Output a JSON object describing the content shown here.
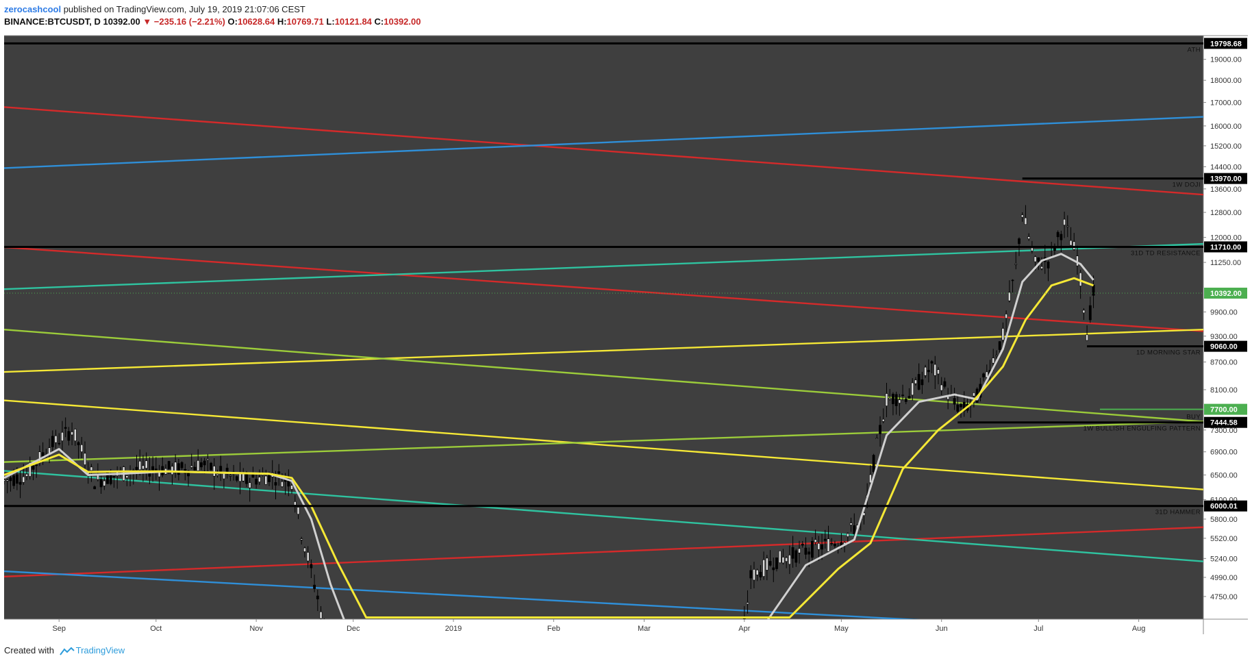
{
  "header": {
    "author": "zerocashcool",
    "published": " published on TradingView.com, July 19, 2019 21:07:06 CEST",
    "symbol": "BINANCE:BTCUSDT, D",
    "last": "10392.00",
    "change": "▼ −235.16 (−2.21%)",
    "o_label": "O:",
    "o_value": "10628.64",
    "h_label": "H:",
    "h_value": "10769.71",
    "l_label": "L:",
    "l_value": "10121.84",
    "c_label": "C:",
    "c_value": "10392.00"
  },
  "footer": {
    "created_with": "Created with",
    "brand": "TradingView"
  },
  "colors": {
    "plot_bg": "#3f3f3f",
    "red": "#d42a2a",
    "blue": "#2f8fd8",
    "teal": "#2fc3a0",
    "yellow": "#f5e836",
    "lime": "#9ccc3a",
    "ema_fast": "#d0d0d0",
    "ema_slow": "#f5e836",
    "candle": "#000000",
    "level": "#000000",
    "last_price": "#4caf50"
  },
  "chart_data": {
    "type": "line",
    "title": "",
    "xlabel": "",
    "ylabel": "",
    "ylim": [
      4480,
      20200
    ],
    "scale": "log",
    "grid": false,
    "x_ticks": [
      "Sep",
      "Oct",
      "Nov",
      "Dec",
      "2019",
      "Feb",
      "Mar",
      "Apr",
      "May",
      "Jun",
      "Jul",
      "Aug"
    ],
    "x_tick_dates": [
      "2018-09-01",
      "2018-10-01",
      "2018-11-01",
      "2018-12-01",
      "2019-01-01",
      "2019-02-01",
      "2019-03-01",
      "2019-04-01",
      "2019-05-01",
      "2019-06-01",
      "2019-07-01",
      "2019-08-01"
    ],
    "x_range": [
      "2018-08-15",
      "2019-08-21"
    ],
    "y_ticks": [
      19000,
      18000,
      17000,
      16000,
      15200,
      14400,
      13600,
      12800,
      12000,
      11250,
      9900,
      9300,
      8700,
      8100,
      7300,
      6900,
      6500,
      6100,
      5800,
      5520,
      5240,
      4990,
      4750
    ],
    "horizontal_levels": [
      {
        "price": 19798.68,
        "label": "19798.68",
        "annotation": "ATH",
        "from": "2018-08-15",
        "to": "2019-08-21"
      },
      {
        "price": 13970.0,
        "label": "13970.00",
        "annotation": "1W DOJI",
        "from": "2019-06-26",
        "to": "2019-08-21"
      },
      {
        "price": 11710.0,
        "label": "11710.00",
        "annotation": "31D TD RESISTANCE",
        "from": "2018-08-15",
        "to": "2019-08-21"
      },
      {
        "price": 9060.0,
        "label": "9060.00",
        "annotation": "1D MORNING STAR",
        "from": "2019-07-16",
        "to": "2019-08-21"
      },
      {
        "price": 7444.58,
        "label": "7444.58",
        "annotation": "1W BULLISH ENGULFING PATTERN",
        "from": "2019-06-06",
        "to": "2019-08-21"
      },
      {
        "price": 6000.01,
        "label": "6000.01",
        "annotation": "31D HAMMER",
        "from": "2018-08-15",
        "to": "2019-08-21"
      }
    ],
    "buy_level": {
      "price": 7700.0,
      "label": "7700.00",
      "annotation": "BUY",
      "from": "2019-07-20",
      "to": "2019-08-21"
    },
    "last_price": {
      "price": 10392.0,
      "label": "10392.00"
    },
    "trend_lines": [
      {
        "color": "red",
        "from": [
          "2018-08-15",
          16800
        ],
        "to": [
          "2019-08-21",
          13400
        ]
      },
      {
        "color": "red",
        "from": [
          "2018-08-15",
          11700
        ],
        "to": [
          "2019-08-21",
          9420
        ]
      },
      {
        "color": "red",
        "from": [
          "2018-08-15",
          5000
        ],
        "to": [
          "2019-08-21",
          5680
        ]
      },
      {
        "color": "blue",
        "from": [
          "2018-08-15",
          14350
        ],
        "to": [
          "2019-08-21",
          16380
        ]
      },
      {
        "color": "blue",
        "from": [
          "2018-08-15",
          5070
        ],
        "to": [
          "2019-08-21",
          4300
        ]
      },
      {
        "color": "teal",
        "from": [
          "2018-08-15",
          10500
        ],
        "to": [
          "2019-08-21",
          11800
        ]
      },
      {
        "color": "teal",
        "from": [
          "2018-08-15",
          6570
        ],
        "to": [
          "2019-08-21",
          5200
        ]
      },
      {
        "color": "yellow",
        "from": [
          "2018-08-15",
          8480
        ],
        "to": [
          "2019-08-21",
          9460
        ]
      },
      {
        "color": "yellow",
        "from": [
          "2018-08-15",
          7880
        ],
        "to": [
          "2019-08-21",
          6260
        ]
      },
      {
        "color": "lime",
        "from": [
          "2018-08-15",
          9460
        ],
        "to": [
          "2019-08-21",
          7460
        ]
      },
      {
        "color": "lime",
        "from": [
          "2018-08-15",
          6720
        ],
        "to": [
          "2019-08-21",
          7460
        ]
      }
    ],
    "series": [
      {
        "name": "",
        "role": "price",
        "x": [
          "2018-08-15",
          "2018-08-22",
          "2018-08-29",
          "2018-09-05",
          "2018-09-12",
          "2018-09-19",
          "2018-09-26",
          "2018-10-03",
          "2018-10-10",
          "2018-10-15",
          "2018-10-22",
          "2018-10-29",
          "2018-11-05",
          "2018-11-12",
          "2018-11-15",
          "2018-11-19",
          "2018-11-22",
          "2018-11-25",
          "2019-03-31",
          "2019-04-03",
          "2019-04-10",
          "2019-04-17",
          "2019-04-24",
          "2019-05-01",
          "2019-05-08",
          "2019-05-12",
          "2019-05-15",
          "2019-05-22",
          "2019-05-29",
          "2019-06-05",
          "2019-06-08",
          "2019-06-12",
          "2019-06-16",
          "2019-06-20",
          "2019-06-24",
          "2019-06-26",
          "2019-06-30",
          "2019-07-04",
          "2019-07-09",
          "2019-07-13",
          "2019-07-16",
          "2019-07-18"
        ],
        "values": [
          6400,
          6500,
          7000,
          7300,
          6400,
          6500,
          6600,
          6600,
          6600,
          6700,
          6500,
          6400,
          6500,
          6400,
          5600,
          4900,
          4400,
          4200,
          4100,
          5000,
          5200,
          5300,
          5400,
          5500,
          5800,
          7000,
          7900,
          8000,
          8600,
          7800,
          7700,
          7950,
          8600,
          9300,
          11100,
          12800,
          11200,
          11300,
          12400,
          11400,
          9400,
          10392
        ]
      },
      {
        "name": "",
        "role": "ema_fast",
        "x": [
          "2018-08-15",
          "2018-09-01",
          "2018-09-10",
          "2018-09-20",
          "2018-10-05",
          "2018-10-20",
          "2018-11-05",
          "2018-11-12",
          "2018-11-18",
          "2018-11-24",
          "2018-11-30",
          "2019-04-05",
          "2019-04-20",
          "2019-05-05",
          "2019-05-15",
          "2019-05-25",
          "2019-06-05",
          "2019-06-12",
          "2019-06-20",
          "2019-06-26",
          "2019-07-02",
          "2019-07-08",
          "2019-07-14",
          "2019-07-18"
        ],
        "values": [
          6450,
          6950,
          6500,
          6520,
          6560,
          6540,
          6520,
          6400,
          5800,
          4900,
          4300,
          4300,
          5150,
          5500,
          7200,
          7850,
          8000,
          7900,
          9000,
          10700,
          11300,
          11500,
          11200,
          10750
        ]
      },
      {
        "name": "",
        "role": "ema_slow",
        "x": [
          "2018-08-15",
          "2018-09-01",
          "2018-09-10",
          "2018-09-20",
          "2018-10-05",
          "2018-10-20",
          "2018-11-05",
          "2018-11-12",
          "2018-11-18",
          "2018-11-26",
          "2018-12-05",
          "2019-04-15",
          "2019-04-30",
          "2019-05-10",
          "2019-05-20",
          "2019-05-31",
          "2019-06-10",
          "2019-06-20",
          "2019-06-27",
          "2019-07-05",
          "2019-07-12",
          "2019-07-18"
        ],
        "values": [
          6500,
          6850,
          6550,
          6560,
          6560,
          6540,
          6520,
          6450,
          6000,
          5200,
          4500,
          4500,
          5100,
          5450,
          6600,
          7300,
          7800,
          8600,
          9700,
          10600,
          10800,
          10600
        ]
      }
    ]
  }
}
